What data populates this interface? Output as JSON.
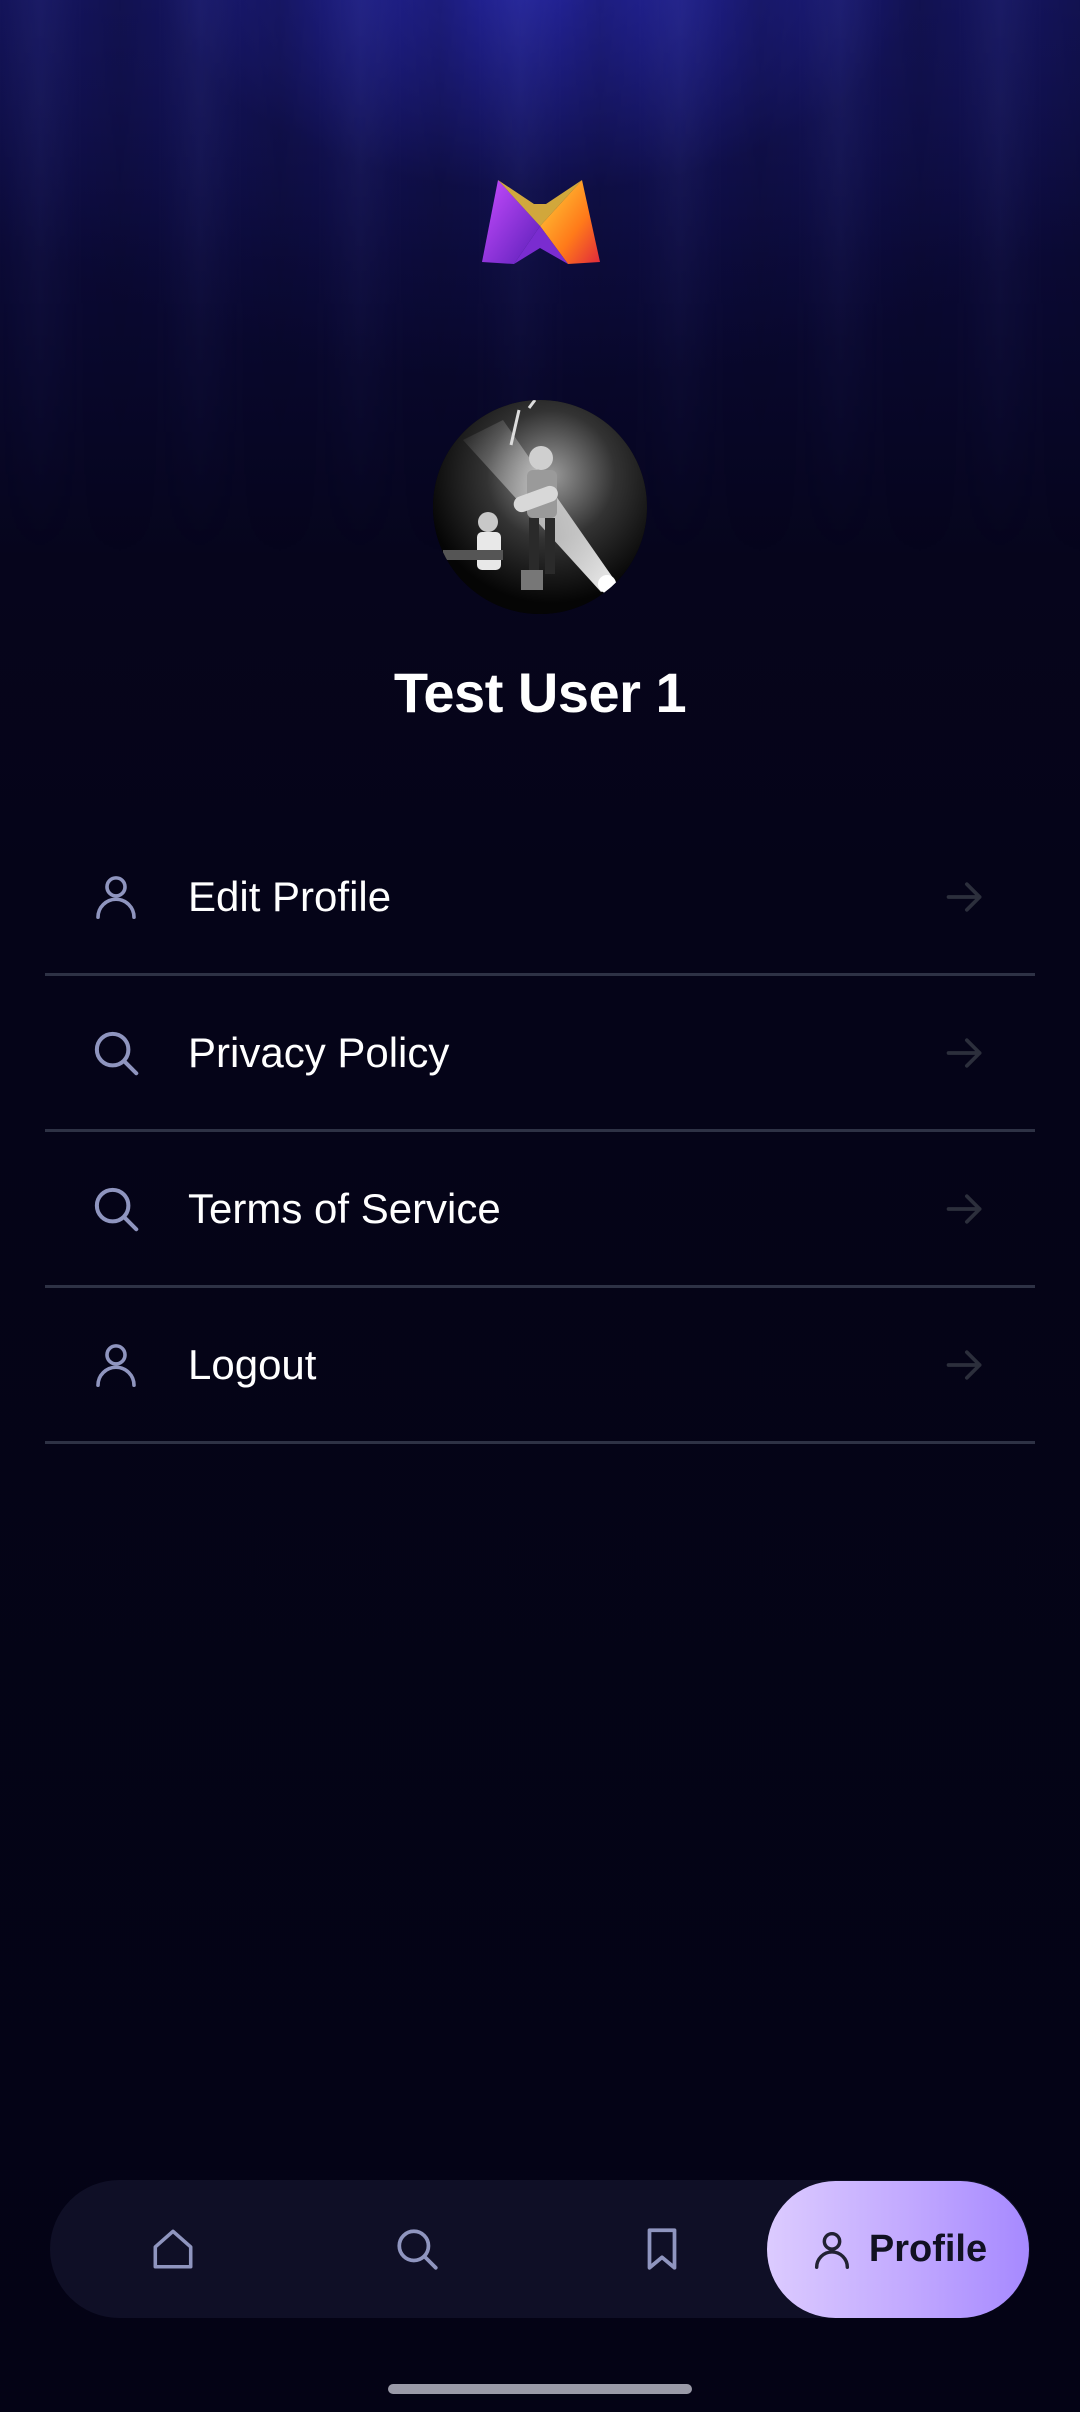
{
  "profile": {
    "username": "Test User 1",
    "avatar_icon": "avatar-photo"
  },
  "menu": [
    {
      "id": "edit-profile",
      "label": "Edit Profile",
      "icon": "person-icon"
    },
    {
      "id": "privacy-policy",
      "label": "Privacy Policy",
      "icon": "search-icon"
    },
    {
      "id": "terms-of-service",
      "label": "Terms of Service",
      "icon": "search-icon"
    },
    {
      "id": "logout",
      "label": "Logout",
      "icon": "person-icon"
    }
  ],
  "bottom_nav": {
    "items": [
      {
        "id": "home",
        "icon": "home-icon"
      },
      {
        "id": "search",
        "icon": "search-icon"
      },
      {
        "id": "saved",
        "icon": "bookmark-icon"
      },
      {
        "id": "profile",
        "icon": "person-icon",
        "label": "Profile",
        "active": true
      }
    ]
  },
  "colors": {
    "background": "#050418",
    "accent_start": "#dccbff",
    "accent_end": "#a689ff",
    "divider": "#2e3245",
    "icon": "#8f95bf"
  }
}
